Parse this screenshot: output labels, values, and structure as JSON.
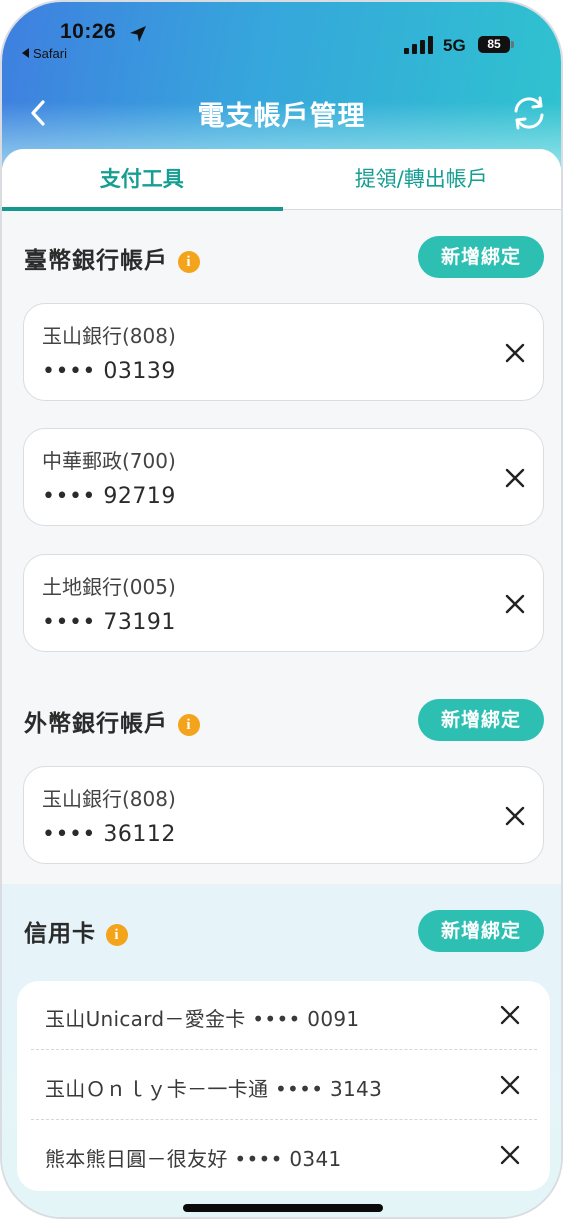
{
  "status_bar": {
    "time": "10:26",
    "back_app": "Safari",
    "network": "5G",
    "battery": "85"
  },
  "nav": {
    "title": "電支帳戶管理"
  },
  "tabs": [
    {
      "label": "支付工具",
      "active": true
    },
    {
      "label": "提領/轉出帳戶",
      "active": false
    }
  ],
  "twd_section": {
    "title": "臺幣銀行帳戶",
    "info_icon": "i",
    "add_label": "新增綁定",
    "accounts": [
      {
        "bank": "玉山銀行(808)",
        "number": "•••• 03139"
      },
      {
        "bank": "中華郵政(700)",
        "number": "•••• 92719"
      },
      {
        "bank": "土地銀行(005)",
        "number": "•••• 73191"
      }
    ]
  },
  "fx_section": {
    "title": "外幣銀行帳戶",
    "info_icon": "i",
    "add_label": "新增綁定",
    "accounts": [
      {
        "bank": "玉山銀行(808)",
        "number": "•••• 36112"
      }
    ]
  },
  "cc_section": {
    "title": "信用卡",
    "info_icon": "i",
    "add_label": "新增綁定",
    "cards": [
      {
        "label": "玉山Unicard－愛金卡 •••• 0091"
      },
      {
        "label": "玉山Ｏｎｌｙ卡－一卡通 •••• 3143"
      },
      {
        "label": "熊本熊日圓－很友好 •••• 0341"
      }
    ]
  },
  "colors": {
    "accent": "#2ebfb3",
    "tab_text": "#169e93",
    "info": "#f4a41a",
    "header_start": "#3f7fe0",
    "header_end": "#2fc3cf"
  },
  "icons": [
    "location-arrow-icon",
    "signal-icon",
    "battery-icon",
    "back-arrow-icon",
    "refresh-icon",
    "info-icon",
    "close-icon"
  ]
}
